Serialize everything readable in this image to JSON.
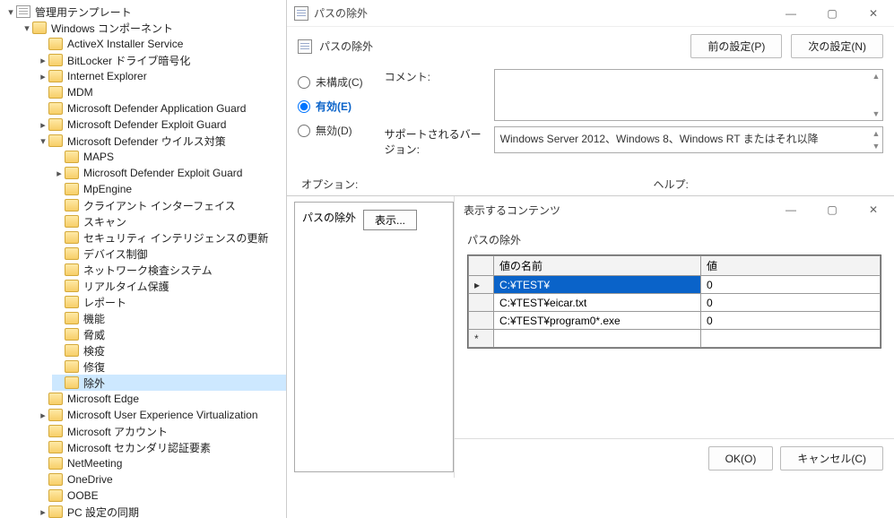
{
  "tree": {
    "root": "管理用テンプレート",
    "win_components": "Windows コンポーネント",
    "items": {
      "activex": "ActiveX Installer Service",
      "bitlocker": "BitLocker ドライブ暗号化",
      "ie": "Internet Explorer",
      "mdm": "MDM",
      "mdag": "Microsoft Defender Application Guard",
      "mdeg": "Microsoft Defender Exploit Guard",
      "mdav": "Microsoft Defender ウイルス対策",
      "maps": "MAPS",
      "mdeg2": "Microsoft Defender Exploit Guard",
      "mpengine": "MpEngine",
      "client_if": "クライアント インターフェイス",
      "scan": "スキャン",
      "sec_intel": "セキュリティ インテリジェンスの更新",
      "device_ctrl": "デバイス制御",
      "net_inspect": "ネットワーク検査システム",
      "realtime": "リアルタイム保護",
      "report": "レポート",
      "features": "機能",
      "threat": "脅威",
      "quarantine": "検疫",
      "repair": "修復",
      "exclusion": "除外",
      "edge": "Microsoft Edge",
      "uev": "Microsoft User Experience Virtualization",
      "ms_account": "Microsoft アカウント",
      "ms_2fa": "Microsoft セカンダリ認証要素",
      "netmeeting": "NetMeeting",
      "onedrive": "OneDrive",
      "oobe": "OOBE",
      "pcsync": "PC 設定の同期"
    }
  },
  "policy_window": {
    "title": "パスの除外",
    "header_label": "パスの除外",
    "prev_setting": "前の設定(P)",
    "next_setting": "次の設定(N)",
    "radio_unconfigured": "未構成(C)",
    "radio_enabled": "有効(E)",
    "radio_disabled": "無効(D)",
    "comment_label": "コメント:",
    "supported_label": "サポートされるバージョン:",
    "supported_value": "Windows Server 2012、Windows 8、Windows RT またはそれ以降",
    "options_label": "オプション:",
    "help_label": "ヘルプ:",
    "options_entry": "パスの除外",
    "show_button": "表示..."
  },
  "dialog": {
    "title": "表示するコンテンツ",
    "subtitle": "パスの除外",
    "col_name": "値の名前",
    "col_value": "値",
    "rows": [
      {
        "name": "C:¥TEST¥",
        "value": "0"
      },
      {
        "name": "C:¥TEST¥eicar.txt",
        "value": "0"
      },
      {
        "name": "C:¥TEST¥program0*.exe",
        "value": "0"
      }
    ],
    "ok": "OK(O)",
    "cancel": "キャンセル(C)"
  }
}
